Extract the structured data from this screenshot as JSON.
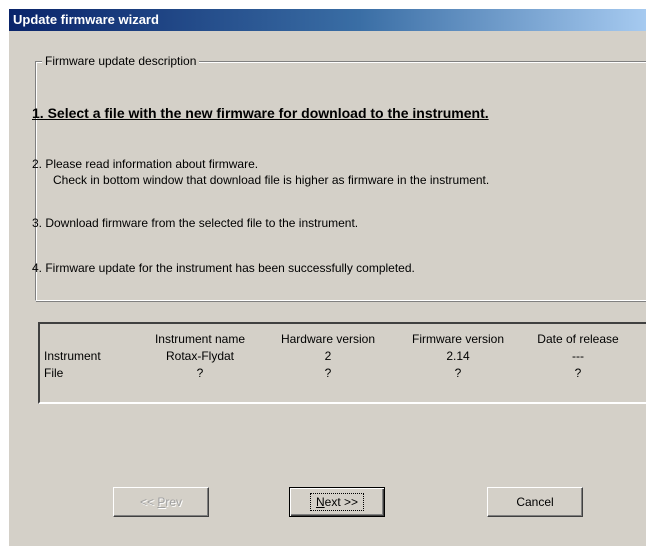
{
  "window": {
    "title": "Update firmware wizard"
  },
  "description": {
    "legend": "Firmware update description",
    "steps": [
      {
        "text": "1. Select a file with the new firmware for download to the instrument.",
        "active": true
      },
      {
        "text": "2. Please read information about firmware.",
        "detail": "Check in bottom window that download file is higher as firmware in the instrument.",
        "active": false
      },
      {
        "text": "3. Download firmware from the selected file to the instrument.",
        "active": false
      },
      {
        "text": "4. Firmware update for the instrument has been successfully completed.",
        "active": false
      }
    ]
  },
  "info_table": {
    "columns": [
      "",
      "Instrument name",
      "Hardware version",
      "Firmware version",
      "Date of release"
    ],
    "rows": [
      [
        "Instrument",
        "Rotax-Flydat",
        "2",
        "2.14",
        "---"
      ],
      [
        "File",
        "?",
        "?",
        "?",
        "?"
      ]
    ]
  },
  "buttons": {
    "prev_prefix": "<< ",
    "prev_mnemonic": "P",
    "prev_rest": "rev",
    "prev_enabled": false,
    "next_mnemonic": "N",
    "next_rest": "ext >>",
    "cancel": "Cancel"
  },
  "colors": {
    "face": "#d4d0c8",
    "title_start": "#0a246a",
    "title_end": "#a6caf0"
  }
}
